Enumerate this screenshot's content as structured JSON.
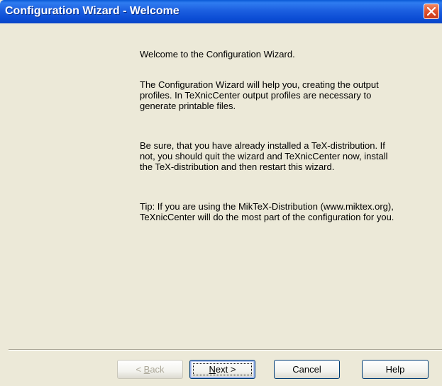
{
  "window": {
    "title": "Configuration Wizard - Welcome"
  },
  "icons": {
    "close": "close-icon"
  },
  "colors": {
    "titlebar": "#0b4cd4",
    "close_button": "#e0502a",
    "dialog_background": "#ece9d8"
  },
  "content": {
    "paragraphs": [
      "Welcome to the Configuration Wizard.",
      "The Configuration Wizard will help you, creating the output profiles. In TeXnicCenter output profiles are necessary to generate printable files.",
      "Be sure, that you have already installed a TeX-distribution. If not, you should quit the wizard and TeXnicCenter now, install the TeX-distribution and then restart this wizard.",
      "Tip: If you are using the MikTeX-Distribution (www.miktex.org), TeXnicCenter will do the most part of the configuration for you."
    ]
  },
  "buttons": {
    "back": {
      "prefix": "< ",
      "mnemonic": "B",
      "rest": "ack",
      "enabled": false
    },
    "next": {
      "mnemonic": "N",
      "rest": "ext >",
      "enabled": true,
      "default": true
    },
    "cancel": {
      "label": "Cancel",
      "enabled": true
    },
    "help": {
      "label": "Help",
      "enabled": true
    }
  }
}
